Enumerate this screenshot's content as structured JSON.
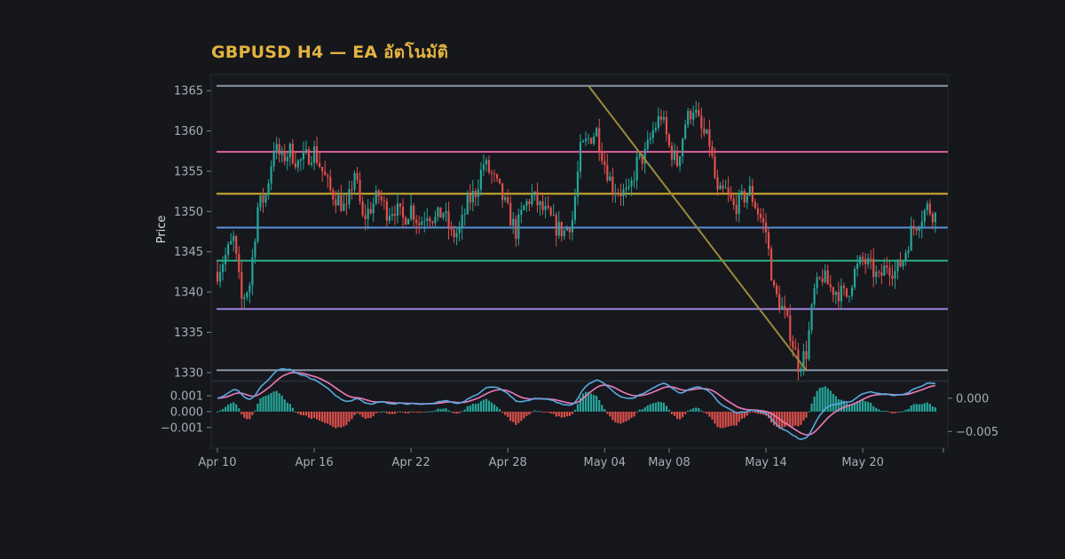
{
  "chart_data": [
    {
      "type": "candlestick",
      "title": "GBPUSD H4 — EA อัตโนมัติ",
      "ylabel": "Price",
      "ylim": [
        1329,
        1367
      ],
      "x_range": [
        "Apr 10",
        "May 25"
      ],
      "y_ticks": [
        1330,
        1335,
        1340,
        1345,
        1350,
        1355,
        1360,
        1365
      ],
      "x_ticks": [
        {
          "label": "Apr 10",
          "date": "2024-04-10"
        },
        {
          "label": "Apr 16",
          "date": "2024-04-16"
        },
        {
          "label": "Apr 22",
          "date": "2024-04-22"
        },
        {
          "label": "Apr 28",
          "date": "2024-04-28"
        },
        {
          "label": "May 04",
          "date": "2024-05-04"
        },
        {
          "label": "May 08",
          "date": "2024-05-08"
        },
        {
          "label": "May 14",
          "date": "2024-05-14"
        },
        {
          "label": "May 20",
          "date": "2024-05-20"
        }
      ],
      "close_path": [
        [
          "2024-04-10",
          1342.5
        ],
        [
          "2024-04-11",
          1346.5
        ],
        [
          "2024-04-11T12:00",
          1339
        ],
        [
          "2024-04-12",
          1341
        ],
        [
          "2024-04-12T12:00",
          1350.5
        ],
        [
          "2024-04-13",
          1352
        ],
        [
          "2024-04-13T12:00",
          1358
        ],
        [
          "2024-04-14",
          1356.5
        ],
        [
          "2024-04-14T12:00",
          1357.5
        ],
        [
          "2024-04-15",
          1356
        ],
        [
          "2024-04-16",
          1357.5
        ],
        [
          "2024-04-16T12:00",
          1355
        ],
        [
          "2024-04-17",
          1352.5
        ],
        [
          "2024-04-17T12:00",
          1351.5
        ],
        [
          "2024-04-18",
          1350
        ],
        [
          "2024-04-18T12:00",
          1355
        ],
        [
          "2024-04-19",
          1349
        ],
        [
          "2024-04-19T12:00",
          1350.5
        ],
        [
          "2024-04-20",
          1352
        ],
        [
          "2024-04-20T12:00",
          1350
        ],
        [
          "2024-04-21",
          1350.5
        ],
        [
          "2024-04-21T12:00",
          1349
        ],
        [
          "2024-04-22",
          1350.5
        ],
        [
          "2024-04-22T12:00",
          1348.5
        ],
        [
          "2024-04-23",
          1350
        ],
        [
          "2024-04-23T12:00",
          1349
        ],
        [
          "2024-04-24",
          1350
        ],
        [
          "2024-04-24T12:00",
          1347
        ],
        [
          "2024-04-25",
          1347.5
        ],
        [
          "2024-04-25T12:00",
          1351
        ],
        [
          "2024-04-26",
          1352.5
        ],
        [
          "2024-04-26T12:00",
          1356
        ],
        [
          "2024-04-27",
          1354.5
        ],
        [
          "2024-04-27T12:00",
          1352.5
        ],
        [
          "2024-04-28",
          1350
        ],
        [
          "2024-04-28T12:00",
          1347.5
        ],
        [
          "2024-04-29",
          1350.5
        ],
        [
          "2024-04-29T12:00",
          1352
        ],
        [
          "2024-04-30",
          1350.5
        ],
        [
          "2024-04-30T12:00",
          1349.5
        ],
        [
          "2024-05-01",
          1348
        ],
        [
          "2024-05-01T12:00",
          1347.5
        ],
        [
          "2024-05-02",
          1349
        ],
        [
          "2024-05-02T12:00",
          1357.5
        ],
        [
          "2024-05-03",
          1359
        ],
        [
          "2024-05-03T12:00",
          1360
        ],
        [
          "2024-05-04",
          1356
        ],
        [
          "2024-05-04T12:00",
          1353
        ],
        [
          "2024-05-05",
          1352.5
        ],
        [
          "2024-05-05T12:00",
          1352
        ],
        [
          "2024-05-06",
          1356
        ],
        [
          "2024-05-06T12:00",
          1357
        ],
        [
          "2024-05-07",
          1360
        ],
        [
          "2024-05-07T12:00",
          1362
        ],
        [
          "2024-05-08",
          1358
        ],
        [
          "2024-05-08T12:00",
          1356
        ],
        [
          "2024-05-09",
          1361
        ],
        [
          "2024-05-09T12:00",
          1363
        ],
        [
          "2024-05-10",
          1360
        ],
        [
          "2024-05-10T12:00",
          1358.5
        ],
        [
          "2024-05-11",
          1352
        ],
        [
          "2024-05-11T12:00",
          1352.5
        ],
        [
          "2024-05-12",
          1350.5
        ],
        [
          "2024-05-12T12:00",
          1351.5
        ],
        [
          "2024-05-13",
          1352.5
        ],
        [
          "2024-05-13T12:00",
          1350
        ],
        [
          "2024-05-14",
          1347.5
        ],
        [
          "2024-05-14T12:00",
          1340
        ],
        [
          "2024-05-15",
          1338
        ],
        [
          "2024-05-15T12:00",
          1335
        ],
        [
          "2024-05-16",
          1331
        ],
        [
          "2024-05-16T12:00",
          1332.5
        ],
        [
          "2024-05-17",
          1340
        ],
        [
          "2024-05-17T12:00",
          1342
        ],
        [
          "2024-05-18",
          1340.5
        ],
        [
          "2024-05-18T12:00",
          1340
        ],
        [
          "2024-05-19",
          1339.5
        ],
        [
          "2024-05-19T12:00",
          1342.5
        ],
        [
          "2024-05-20",
          1344
        ],
        [
          "2024-05-20T12:00",
          1343
        ],
        [
          "2024-05-21",
          1341.5
        ],
        [
          "2024-05-21T12:00",
          1343.5
        ],
        [
          "2024-05-22",
          1342.5
        ],
        [
          "2024-05-22T12:00",
          1344
        ],
        [
          "2024-05-23",
          1347.5
        ],
        [
          "2024-05-23T12:00",
          1349
        ],
        [
          "2024-05-24",
          1350.5
        ],
        [
          "2024-05-24T12:00",
          1349.5
        ]
      ],
      "horizontal_levels": [
        {
          "price": 1365.6,
          "color": "#8a95a8"
        },
        {
          "price": 1357.4,
          "color": "#e060a0"
        },
        {
          "price": 1352.2,
          "color": "#d4b030"
        },
        {
          "price": 1348.0,
          "color": "#5b8fd6"
        },
        {
          "price": 1343.9,
          "color": "#2bb07f"
        },
        {
          "price": 1337.9,
          "color": "#9f7fe0"
        },
        {
          "price": 1330.3,
          "color": "#8a95a8"
        }
      ],
      "trendline": {
        "from": [
          "2024-05-03",
          1365.6
        ],
        "to": [
          "2024-05-16T12:00",
          1330.3
        ],
        "color": "#9b8a3c"
      },
      "colors": {
        "up": "#26a69a",
        "down": "#e0504c"
      }
    },
    {
      "type": "macd",
      "ylim_left": [
        -0.0023,
        0.0019
      ],
      "left_ticks": [
        0.001,
        0.0,
        -0.001
      ],
      "left_tick_labels": [
        "0.001",
        "0.000",
        "−0.001"
      ],
      "ylim_right": [
        -0.0075,
        0.0025
      ],
      "right_ticks": [
        0.0,
        -0.005
      ],
      "right_tick_labels": [
        "0.000",
        "−0.005"
      ],
      "colors": {
        "macd": "#5aa8e0",
        "signal": "#ee7ab8",
        "hist_up": "#26a69a",
        "hist_down": "#e0504c"
      }
    }
  ]
}
